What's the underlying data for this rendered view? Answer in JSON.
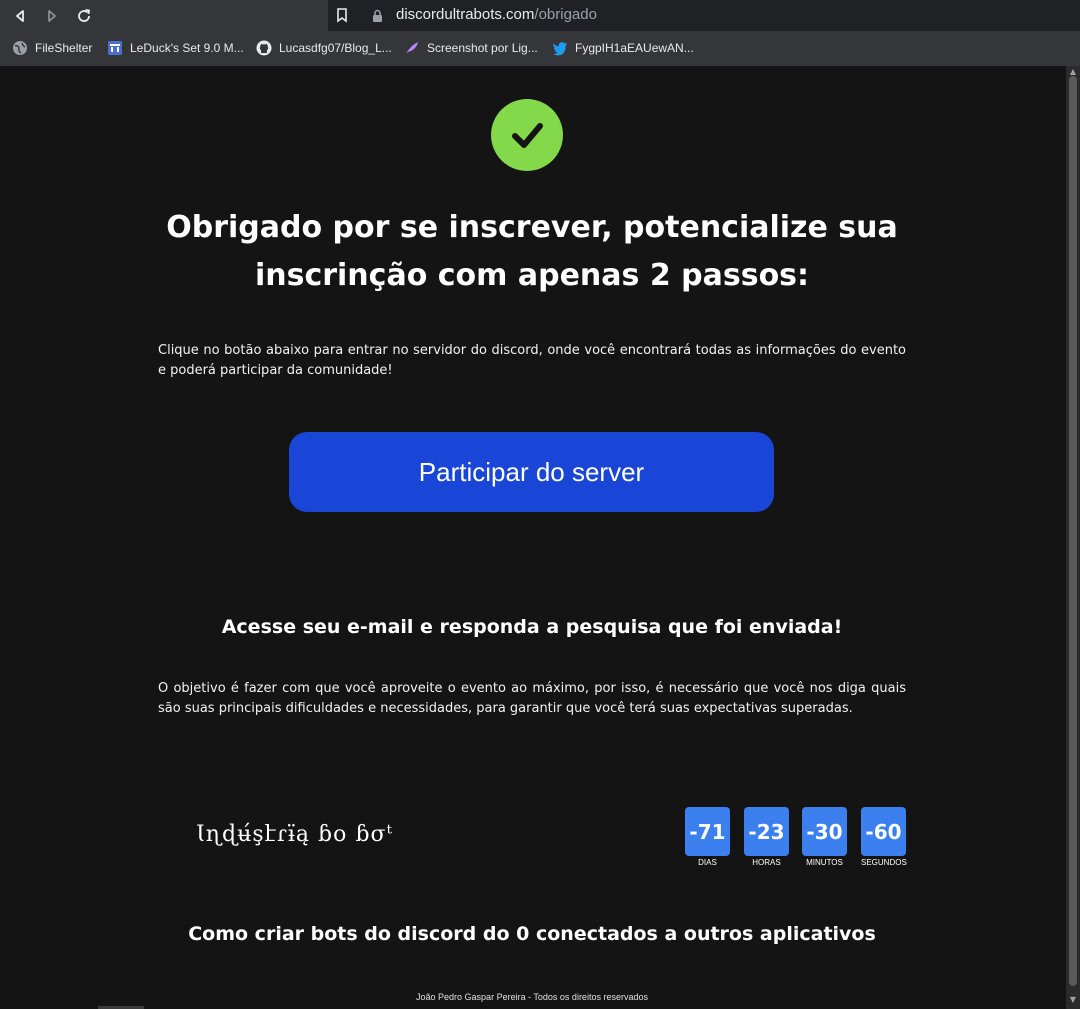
{
  "browser": {
    "url_domain": "discordultrabots.com",
    "url_path": "/obrigado",
    "bookmarks": [
      {
        "label": "FileShelter",
        "icon": "globe-icon"
      },
      {
        "label": "LeDuck's Set 9.0 M...",
        "icon": "trello-icon"
      },
      {
        "label": "Lucasdfg07/Blog_L...",
        "icon": "github-icon"
      },
      {
        "label": "Screenshot por Lig...",
        "icon": "feather-icon"
      },
      {
        "label": "FygpIH1aEAUewAN...",
        "icon": "twitter-icon"
      }
    ]
  },
  "page": {
    "headline": "Obrigado por se inscrever, potencialize sua inscrinção com apenas 2 passos:",
    "intro": "Clique no botão abaixo para entrar no servidor do discord, onde você encontrará todas as informações do evento e poderá participar da comunidade!",
    "cta_label": "Participar do server",
    "email_heading": "Acesse seu e-mail e responda a pesquisa que foi enviada!",
    "email_text": "O objetivo é fazer com que você aproveite o evento ao máximo, por isso, é necessário que você nos diga quais são suas principais dificuldades e necessidades, para garantir que você terá suas expectativas superadas.",
    "brand_text": "Ɩɳɖʉ́şէɾɨ̈ą ɓօ ɓσᵗ",
    "countdown": [
      {
        "value": "-71",
        "label": "DIAS"
      },
      {
        "value": "-23",
        "label": "HORAS"
      },
      {
        "value": "-30",
        "label": "MINUTOS"
      },
      {
        "value": "-60",
        "label": "SEGUNDOS"
      }
    ],
    "event_title": "Como criar bots do discord do 0 conectados a outros aplicativos",
    "footer": "João Pedro Gaspar Pereira - Todos os direitos reservados"
  },
  "colors": {
    "background": "#141414",
    "check": "#84d94a",
    "cta": "#1a46d8",
    "countdown": "#3c80f0"
  }
}
